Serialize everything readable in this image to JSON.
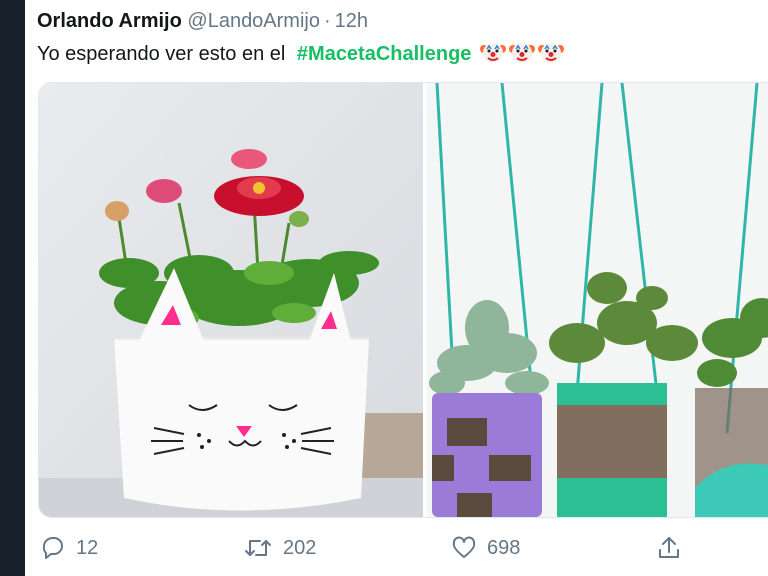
{
  "tweet": {
    "author_name": "Orlando Armijo",
    "handle": "@LandoArmijo",
    "separator": "·",
    "time": "12h",
    "text": "Yo esperando ver esto en el",
    "hashtag": "#MacetaChallenge",
    "emojis": [
      "clown-face",
      "clown-face",
      "clown-face"
    ]
  },
  "media": {
    "photos": [
      {
        "subject": "cat-planter"
      },
      {
        "subject": "hanging-bottle-planters"
      }
    ]
  },
  "actions": {
    "replies": "12",
    "retweets": "202",
    "likes": "698"
  },
  "colors": {
    "hashtag": "#17bf63",
    "secondary_text": "#657786",
    "left_rail": "#15202b"
  }
}
